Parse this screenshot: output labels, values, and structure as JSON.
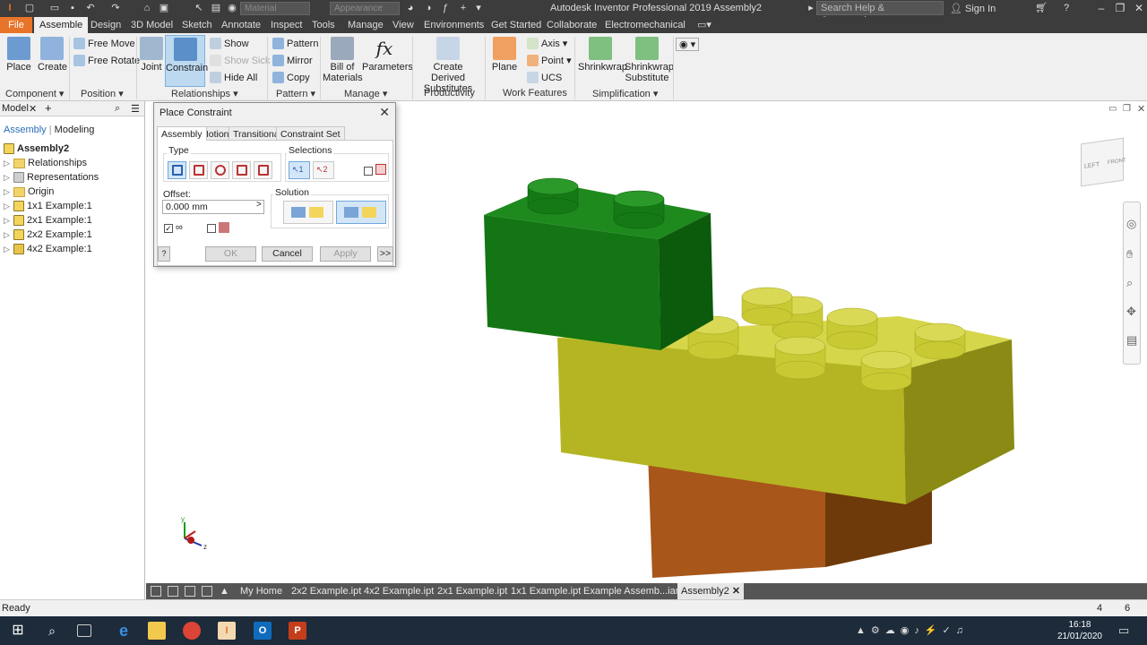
{
  "window": {
    "title": "Autodesk Inventor Professional 2019   Assembly2",
    "material_placeholder": "Material",
    "appearance_placeholder": "Appearance",
    "search_placeholder": "Search Help & Commands...",
    "sign_in": "Sign In"
  },
  "ribbon_tabs": [
    "File",
    "Assemble",
    "Design",
    "3D Model",
    "Sketch",
    "Annotate",
    "Inspect",
    "Tools",
    "Manage",
    "View",
    "Environments",
    "Get Started",
    "Collaborate",
    "Electromechanical"
  ],
  "ribbon": {
    "place": "Place",
    "create": "Create",
    "free_move": "Free Move",
    "free_rotate": "Free Rotate",
    "joint": "Joint",
    "constrain": "Constrain",
    "show": "Show",
    "show_sick": "Show Sick",
    "hide_all": "Hide All",
    "pattern": "Pattern",
    "mirror": "Mirror",
    "copy": "Copy",
    "bom_line1": "Bill of",
    "bom_line2": "Materials",
    "parameters": "Parameters",
    "create_derived_line1": "Create Derived",
    "create_derived_line2": "Substitutes",
    "plane": "Plane",
    "axis": "Axis",
    "point": "Point",
    "ucs": "UCS",
    "shrinkwrap": "Shrinkwrap",
    "shrinkwrap_sub_line1": "Shrinkwrap",
    "shrinkwrap_sub_line2": "Substitute",
    "panels": {
      "component": "Component",
      "position": "Position",
      "relationships": "Relationships",
      "pattern": "Pattern",
      "manage": "Manage",
      "productivity": "Productivity",
      "work_features": "Work Features",
      "simplification": "Simplification"
    }
  },
  "browser": {
    "title": "Model",
    "tab_assembly": "Assembly",
    "tab_modeling": "Modeling",
    "root": "Assembly2",
    "items": [
      "Relationships",
      "Representations",
      "Origin",
      "1x1 Example:1",
      "2x1 Example:1",
      "2x2 Example:1",
      "4x2 Example:1"
    ]
  },
  "dialog": {
    "title": "Place Constraint",
    "tabs": [
      "Assembly",
      "Motion",
      "Transitional",
      "Constraint Set"
    ],
    "type_label": "Type",
    "selections_label": "Selections",
    "sel1": "1",
    "sel2": "2",
    "offset_label": "Offset:",
    "offset_value": "0.000 mm",
    "solution_label": "Solution",
    "ok": "OK",
    "cancel": "Cancel",
    "apply": "Apply",
    "more": ">>",
    "help": "?"
  },
  "view_cube": {
    "left": "LEFT",
    "front": "FRONT"
  },
  "doc_tabs": [
    "My Home",
    "2x2 Example.ipt",
    "4x2 Example.ipt",
    "2x1 Example.ipt",
    "1x1 Example.ipt",
    "Example Assemb...iam",
    "Assembly2"
  ],
  "status": {
    "left": "Ready",
    "count1": "4",
    "count2": "6"
  },
  "taskbar": {
    "time": "16:18",
    "date": "21/01/2020"
  },
  "colors": {
    "accent_file": "#e8742a",
    "brick_green": "#0f6b0f",
    "brick_yellow": "#b8b82a",
    "brick_brown": "#a0520f"
  }
}
